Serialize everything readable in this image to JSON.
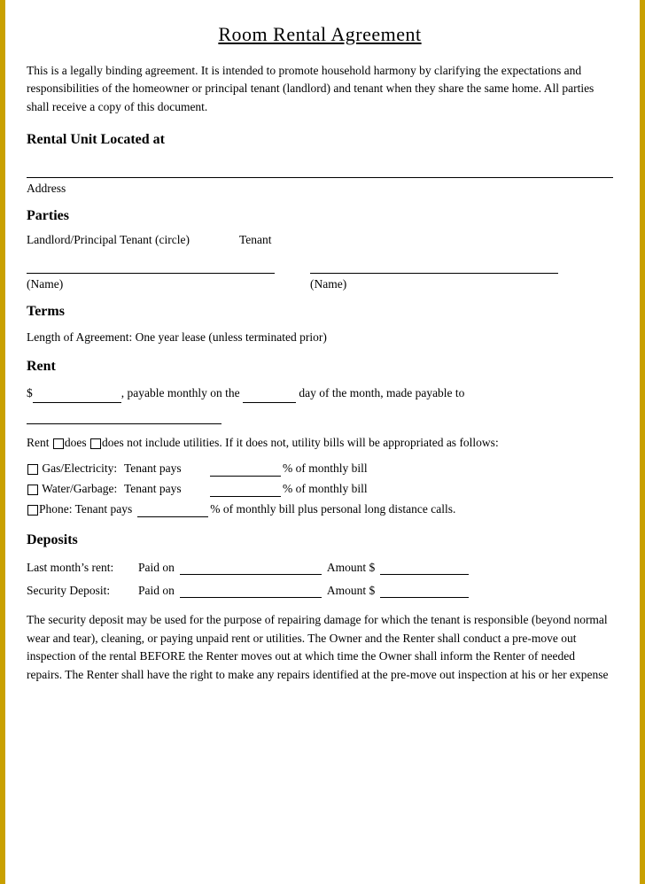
{
  "document": {
    "title": "Room Rental Agreement",
    "intro": "This is a legally binding agreement. It is intended to promote household harmony by clarifying the expectations and responsibilities of the homeowner or principal tenant (landlord) and tenant when they share the same home. All parties shall receive a copy of this document.",
    "sections": {
      "rental_unit": {
        "heading": "Rental Unit Located at",
        "address_label": "Address"
      },
      "parties": {
        "heading": "Parties",
        "landlord_label": "Landlord/Principal Tenant (circle)",
        "tenant_label": "Tenant",
        "name_label": "(Name)",
        "name_label2": "(Name)"
      },
      "terms": {
        "heading": "Terms",
        "length_text": "Length of Agreement: One year lease (unless terminated prior)"
      },
      "rent": {
        "heading": "Rent",
        "rent_line1_prefix": "$",
        "rent_line1_mid": ", payable monthly on the",
        "rent_line1_suffix": "day of the month, made payable to",
        "utilities_text": "Rent □does □does not include utilities. If it does not, utility bills will be appropriated as follows:",
        "gas_label": "□ Gas/Electricity:",
        "gas_tenant": "Tenant pays",
        "gas_suffix": "% of monthly bill",
        "water_label": "□ Water/Garbage:",
        "water_tenant": "Tenant pays",
        "water_suffix": "% of monthly bill",
        "phone_label": "□ Phone: Tenant pays",
        "phone_suffix": "% of monthly bill plus personal long distance calls."
      },
      "deposits": {
        "heading": "Deposits",
        "last_month_label": "Last month’s rent:",
        "last_month_paid": "Paid on",
        "last_month_amount": "Amount $",
        "security_label": "Security Deposit:",
        "security_paid": "Paid on",
        "security_amount": "Amount $",
        "security_text": "The security deposit may be used for the purpose of repairing damage for which the tenant is responsible (beyond normal wear and tear), cleaning, or paying unpaid rent or utilities. The Owner and the Renter shall conduct a pre-move out inspection of the rental BEFORE the Renter moves out at which time the Owner shall inform the Renter of needed repairs. The Renter shall have the right to make any repairs identified at the pre-move out inspection at his or her expense"
      }
    }
  },
  "colors": {
    "accent": "#c9a000",
    "text": "#000000",
    "background": "#ffffff"
  }
}
